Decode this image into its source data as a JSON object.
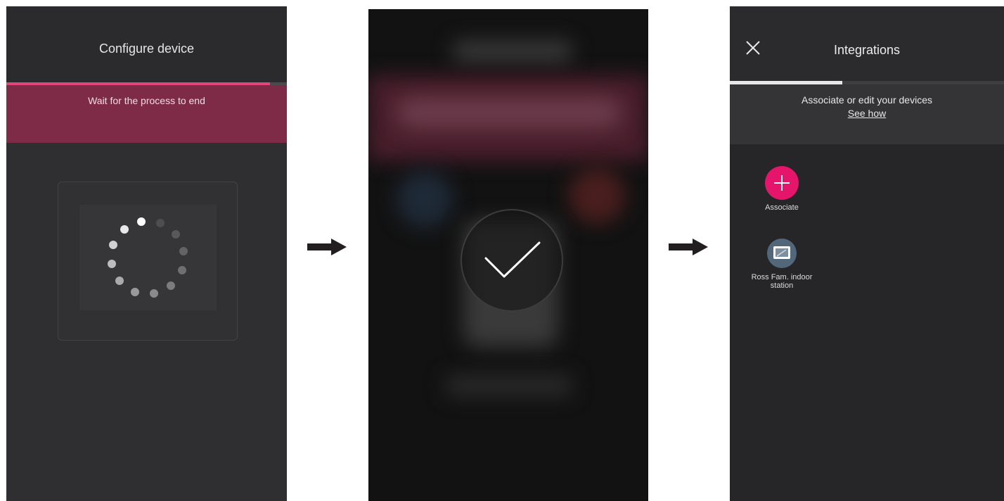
{
  "screen1": {
    "title": "Configure device",
    "banner_text": "Wait for the process to end",
    "progress": 0.94,
    "colors": {
      "accent": "#e0467a",
      "banner": "#7e2b47"
    }
  },
  "screen2": {
    "status_icon": "checkmark-icon"
  },
  "screen3": {
    "title": "Integrations",
    "subtitle": "Associate or edit your devices",
    "help_link": "See how",
    "items": [
      {
        "label": "Associate",
        "icon": "plus-icon",
        "color": "#e5156b"
      },
      {
        "label": "Ross Fam. indoor station",
        "icon": "indoor-station-icon",
        "color": "#52677a"
      }
    ]
  },
  "arrows": [
    "arrow-right-icon",
    "arrow-right-icon"
  ]
}
